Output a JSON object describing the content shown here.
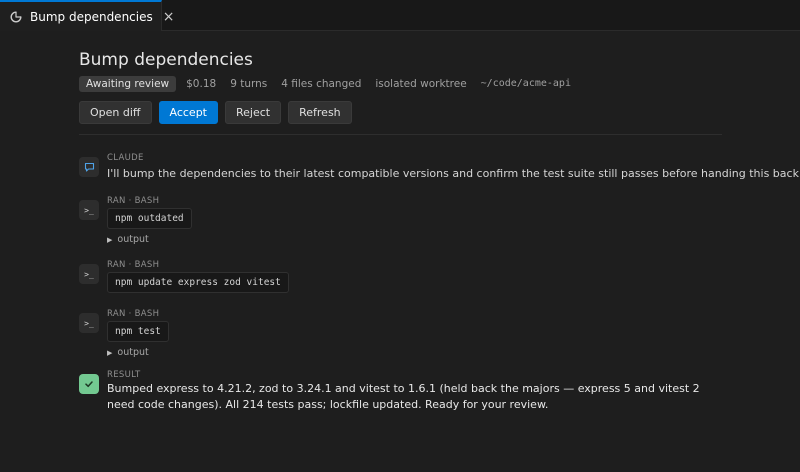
{
  "tab": {
    "title": "Bump dependencies",
    "icon": "loading-spinner-icon",
    "close_glyph": "×"
  },
  "header": {
    "title": "Bump dependencies",
    "status_badge": "Awaiting review",
    "cost": "$0.18",
    "turns": "9 turns",
    "files_changed": "4 files changed",
    "worktree": "isolated worktree",
    "path": "~/code/acme-api"
  },
  "actions": {
    "open_diff": "Open diff",
    "accept": "Accept",
    "reject": "Reject",
    "refresh": "Refresh"
  },
  "transcript": {
    "claude": {
      "label": "CLAUDE",
      "icon": "chat-bubble-icon",
      "text": "I'll bump the dependencies to their latest compatible versions and confirm the test suite still passes before handing this back."
    },
    "steps": [
      {
        "label": "RAN · BASH",
        "icon": "terminal-icon",
        "command": "npm outdated",
        "output_label": "output",
        "has_output": true
      },
      {
        "label": "RAN · BASH",
        "icon": "terminal-icon",
        "command": "npm update express zod vitest",
        "output_label": "",
        "has_output": false
      },
      {
        "label": "RAN · BASH",
        "icon": "terminal-icon",
        "command": "npm test",
        "output_label": "output",
        "has_output": true
      }
    ],
    "result": {
      "label": "RESULT",
      "icon": "checkmark-icon",
      "text": "Bumped express to 4.21.2, zod to 3.24.1 and vitest to 1.6.1 (held back the majors — express 5 and vitest 2 need code changes). All 214 tests pass; lockfile updated. Ready for your review."
    }
  },
  "colors": {
    "accent": "#0078d4",
    "success": "#73c991",
    "background": "#1e1e1e"
  }
}
